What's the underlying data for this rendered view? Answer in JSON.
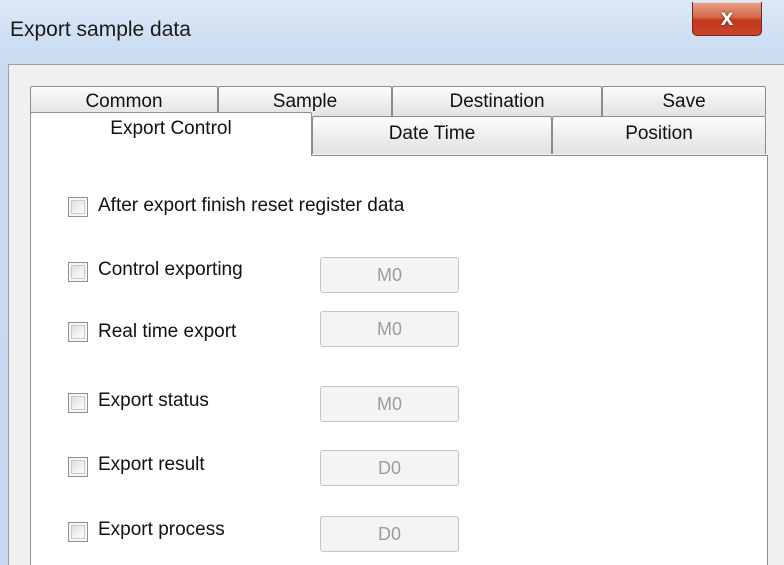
{
  "window": {
    "title": "Export sample data",
    "close_glyph": "x"
  },
  "tabs": {
    "row1": [
      "Common",
      "Sample",
      "Destination",
      "Save"
    ],
    "row2": [
      "Export Control",
      "Date Time",
      "Position"
    ],
    "active": "Export Control"
  },
  "options": {
    "reset_register": {
      "label": "After export finish reset register data",
      "checked": false
    },
    "control_exporting": {
      "label": "Control exporting",
      "checked": false,
      "address": "M0"
    },
    "real_time_export": {
      "label": "Real time export",
      "checked": false,
      "address": "M0"
    },
    "export_status": {
      "label": "Export status",
      "checked": false,
      "address": "M0"
    },
    "export_result": {
      "label": "Export result",
      "checked": false,
      "address": "D0"
    },
    "export_process": {
      "label": "Export process",
      "checked": false,
      "address": "D0"
    }
  }
}
